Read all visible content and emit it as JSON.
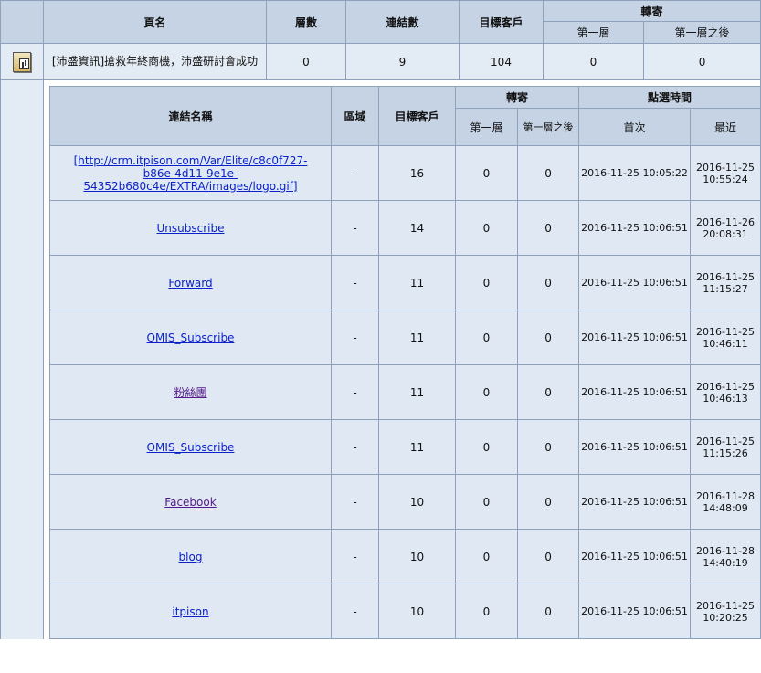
{
  "summary": {
    "headers": {
      "page_name": "頁名",
      "levels": "層數",
      "links": "連結數",
      "targets": "目標客戶",
      "forward": "轉寄",
      "first_level": "第一層",
      "after_first": "第一層之後"
    },
    "row": {
      "page_name": "[沛盛資訊]搶救年終商機，沛盛研討會成功",
      "levels": "0",
      "links": "9",
      "targets": "104",
      "first_level": "0",
      "after_first": "0"
    }
  },
  "links_table": {
    "headers": {
      "link_name": "連結名稱",
      "region": "區域",
      "targets": "目標客戶",
      "forward": "轉寄",
      "first_level": "第一層",
      "after_first": "第一層之後",
      "click_time": "點選時間",
      "first": "首次",
      "latest": "最近"
    },
    "rows": [
      {
        "name": "[http://crm.itpison.com/Var/Elite/c8c0f727-b86e-4d11-9e1e-54352b680c4e/EXTRA/images/logo.gif]",
        "region": "-",
        "targets": "16",
        "first_level": "0",
        "after_first": "0",
        "first_time": "2016-11-25 10:05:22",
        "latest_time": "2016-11-25 10:55:24",
        "visited": false
      },
      {
        "name": "Unsubscribe",
        "region": "-",
        "targets": "14",
        "first_level": "0",
        "after_first": "0",
        "first_time": "2016-11-25 10:06:51",
        "latest_time": "2016-11-26 20:08:31",
        "visited": false
      },
      {
        "name": "Forward",
        "region": "-",
        "targets": "11",
        "first_level": "0",
        "after_first": "0",
        "first_time": "2016-11-25 10:06:51",
        "latest_time": "2016-11-25 11:15:27",
        "visited": false
      },
      {
        "name": "OMIS_Subscribe",
        "region": "-",
        "targets": "11",
        "first_level": "0",
        "after_first": "0",
        "first_time": "2016-11-25 10:06:51",
        "latest_time": "2016-11-25 10:46:11",
        "visited": false
      },
      {
        "name": "粉絲團",
        "region": "-",
        "targets": "11",
        "first_level": "0",
        "after_first": "0",
        "first_time": "2016-11-25 10:06:51",
        "latest_time": "2016-11-25 10:46:13",
        "visited": true
      },
      {
        "name": "OMIS_Subscribe",
        "region": "-",
        "targets": "11",
        "first_level": "0",
        "after_first": "0",
        "first_time": "2016-11-25 10:06:51",
        "latest_time": "2016-11-25 11:15:26",
        "visited": false
      },
      {
        "name": "Facebook",
        "region": "-",
        "targets": "10",
        "first_level": "0",
        "after_first": "0",
        "first_time": "2016-11-25 10:06:51",
        "latest_time": "2016-11-28 14:48:09",
        "visited": true
      },
      {
        "name": "blog",
        "region": "-",
        "targets": "10",
        "first_level": "0",
        "after_first": "0",
        "first_time": "2016-11-25 10:06:51",
        "latest_time": "2016-11-28 14:40:19",
        "visited": false
      },
      {
        "name": "itpison",
        "region": "-",
        "targets": "10",
        "first_level": "0",
        "after_first": "0",
        "first_time": "2016-11-25 10:06:51",
        "latest_time": "2016-11-25 10:20:25",
        "visited": false
      }
    ]
  },
  "icons": {
    "page_icon": "chart-document-icon"
  },
  "colors": {
    "header_bg": "#c5d3e4",
    "row_bg": "#dfe8f3",
    "border": "#8ea3bb",
    "link": "#0b22c9",
    "visited_link": "#551a8b"
  }
}
